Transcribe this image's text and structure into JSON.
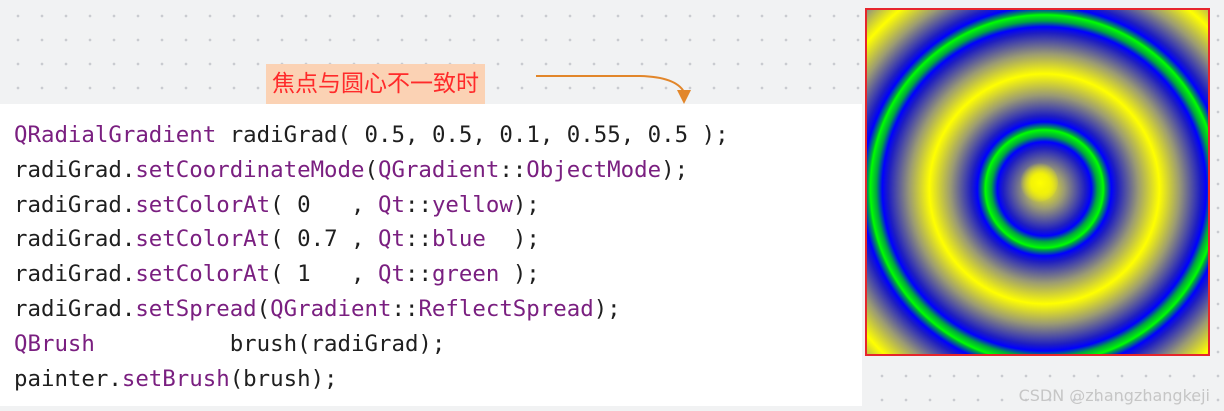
{
  "callout": {
    "text": "焦点与圆心不一致时"
  },
  "code": {
    "lines": [
      [
        {
          "t": "QRadialGradient",
          "c": "p"
        },
        {
          "t": " radiGrad( ",
          "c": "n"
        },
        {
          "t": "0.5",
          "c": "num"
        },
        {
          "t": ", ",
          "c": "n"
        },
        {
          "t": "0.5",
          "c": "num"
        },
        {
          "t": ", ",
          "c": "n"
        },
        {
          "t": "0.1",
          "c": "num"
        },
        {
          "t": ", ",
          "c": "n"
        },
        {
          "t": "0.55",
          "c": "num"
        },
        {
          "t": ", ",
          "c": "n"
        },
        {
          "t": "0.5",
          "c": "num"
        },
        {
          "t": " );",
          "c": "n"
        }
      ],
      [
        {
          "t": "radiGrad.",
          "c": "n"
        },
        {
          "t": "setCoordinateMode",
          "c": "p"
        },
        {
          "t": "(",
          "c": "n"
        },
        {
          "t": "QGradient",
          "c": "p"
        },
        {
          "t": "::",
          "c": "n"
        },
        {
          "t": "ObjectMode",
          "c": "p"
        },
        {
          "t": ");",
          "c": "n"
        }
      ],
      [
        {
          "t": "radiGrad.",
          "c": "n"
        },
        {
          "t": "setColorAt",
          "c": "p"
        },
        {
          "t": "( ",
          "c": "n"
        },
        {
          "t": "0",
          "c": "num"
        },
        {
          "t": "   , ",
          "c": "n"
        },
        {
          "t": "Qt",
          "c": "p"
        },
        {
          "t": "::",
          "c": "n"
        },
        {
          "t": "yellow",
          "c": "p"
        },
        {
          "t": ");",
          "c": "n"
        }
      ],
      [
        {
          "t": "radiGrad.",
          "c": "n"
        },
        {
          "t": "setColorAt",
          "c": "p"
        },
        {
          "t": "( ",
          "c": "n"
        },
        {
          "t": "0.7",
          "c": "num"
        },
        {
          "t": " , ",
          "c": "n"
        },
        {
          "t": "Qt",
          "c": "p"
        },
        {
          "t": "::",
          "c": "n"
        },
        {
          "t": "blue",
          "c": "p"
        },
        {
          "t": "  );",
          "c": "n"
        }
      ],
      [
        {
          "t": "radiGrad.",
          "c": "n"
        },
        {
          "t": "setColorAt",
          "c": "p"
        },
        {
          "t": "( ",
          "c": "n"
        },
        {
          "t": "1",
          "c": "num"
        },
        {
          "t": "   , ",
          "c": "n"
        },
        {
          "t": "Qt",
          "c": "p"
        },
        {
          "t": "::",
          "c": "n"
        },
        {
          "t": "green",
          "c": "p"
        },
        {
          "t": " );",
          "c": "n"
        }
      ],
      [
        {
          "t": "radiGrad.",
          "c": "n"
        },
        {
          "t": "setSpread",
          "c": "p"
        },
        {
          "t": "(",
          "c": "n"
        },
        {
          "t": "QGradient",
          "c": "p"
        },
        {
          "t": "::",
          "c": "n"
        },
        {
          "t": "ReflectSpread",
          "c": "p"
        },
        {
          "t": ");",
          "c": "n"
        }
      ],
      [
        {
          "t": "QBrush",
          "c": "p"
        },
        {
          "t": "          brush(radiGrad);",
          "c": "n"
        }
      ],
      [
        {
          "t": "painter.",
          "c": "n"
        },
        {
          "t": "setBrush",
          "c": "p"
        },
        {
          "t": "(brush);",
          "c": "n"
        }
      ]
    ]
  },
  "gradient": {
    "colors": [
      "#ffff00",
      "#0000ff",
      "#00ff00"
    ],
    "border_color": "#e6262c"
  },
  "watermark": {
    "text": "CSDN @zhangzhangkeji"
  },
  "colors": {
    "keyword_purple": "#7a1f80",
    "callout_text": "#ff2a2a",
    "callout_bg": "#fbd2b4",
    "arrow": "#e2862a"
  }
}
